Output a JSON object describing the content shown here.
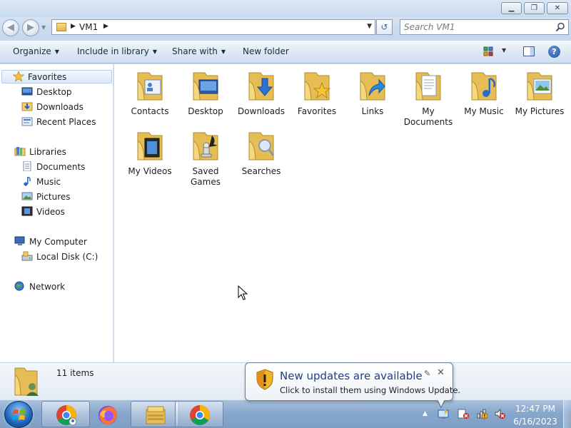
{
  "window": {
    "min_glyph": "▁",
    "max_glyph": "❐",
    "close_glyph": "✕"
  },
  "address": {
    "path": "VM1",
    "refresh_glyph": "↺",
    "back_glyph": "◀",
    "forward_glyph": "▶"
  },
  "search": {
    "placeholder": "Search VM1"
  },
  "toolbar": {
    "organize": "Organize",
    "include_in_library": "Include in library",
    "share_with": "Share with",
    "new_folder": "New folder",
    "help_glyph": "?"
  },
  "sidebar": {
    "favorites": {
      "label": "Favorites",
      "items": [
        {
          "label": "Desktop",
          "icon": "desktop-icon"
        },
        {
          "label": "Downloads",
          "icon": "downloads-icon"
        },
        {
          "label": "Recent Places",
          "icon": "recent-places-icon"
        }
      ]
    },
    "libraries": {
      "label": "Libraries",
      "items": [
        {
          "label": "Documents",
          "icon": "documents-icon"
        },
        {
          "label": "Music",
          "icon": "music-icon"
        },
        {
          "label": "Pictures",
          "icon": "pictures-icon"
        },
        {
          "label": "Videos",
          "icon": "videos-icon"
        }
      ]
    },
    "computer": {
      "label": "My Computer",
      "items": [
        {
          "label": "Local Disk (C:)",
          "icon": "local-disk-icon"
        }
      ]
    },
    "network": {
      "label": "Network"
    }
  },
  "folders": [
    {
      "label": "Contacts",
      "icon": "contacts-folder-icon"
    },
    {
      "label": "Desktop",
      "icon": "desktop-folder-icon"
    },
    {
      "label": "Downloads",
      "icon": "downloads-folder-icon"
    },
    {
      "label": "Favorites",
      "icon": "favorites-folder-icon"
    },
    {
      "label": "Links",
      "icon": "links-folder-icon"
    },
    {
      "label": "My Documents",
      "icon": "documents-folder-icon"
    },
    {
      "label": "My Music",
      "icon": "music-folder-icon"
    },
    {
      "label": "My Pictures",
      "icon": "pictures-folder-icon"
    },
    {
      "label": "My Videos",
      "icon": "videos-folder-icon"
    },
    {
      "label": "Saved Games",
      "icon": "saved-games-folder-icon"
    },
    {
      "label": "Searches",
      "icon": "searches-folder-icon"
    }
  ],
  "details": {
    "item_count": "11 items"
  },
  "notification": {
    "title": "New updates are available",
    "text": "Click to install them using Windows Update.",
    "close_glyph": "✕",
    "pin_glyph": "✎"
  },
  "taskbar": {
    "apps": [
      {
        "name": "chrome-user",
        "icon": "chrome-profile-icon"
      },
      {
        "name": "firefox",
        "icon": "firefox-icon"
      },
      {
        "name": "file-explorer",
        "icon": "explorer-icon"
      },
      {
        "name": "chrome",
        "icon": "chrome-icon"
      }
    ],
    "tray_up_glyph": "▲",
    "time": "12:47 PM",
    "date": "6/16/2023"
  }
}
